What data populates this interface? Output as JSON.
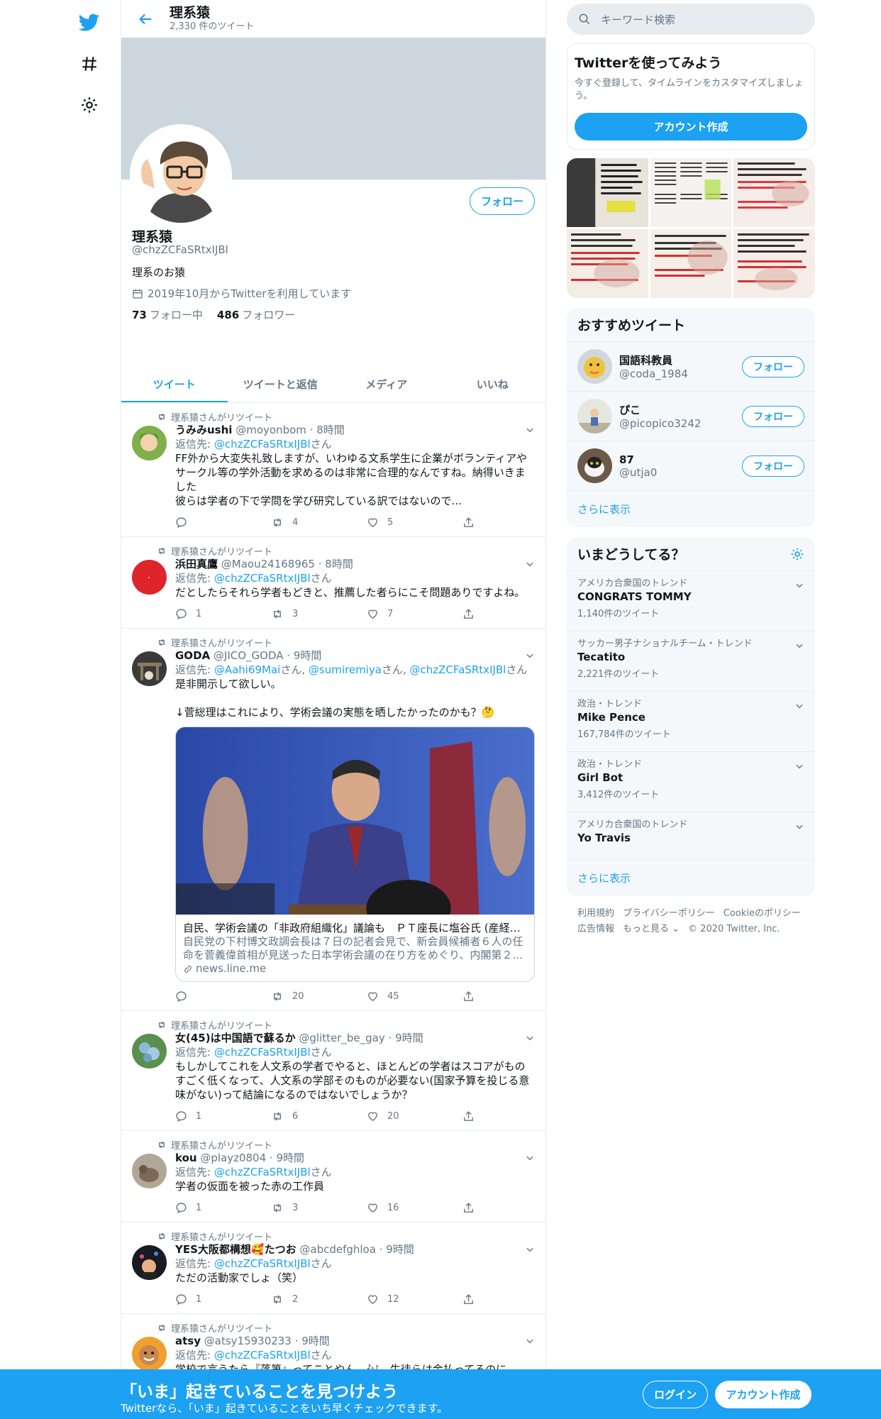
{
  "colors": {
    "accent": "#1da1f2",
    "muted": "#657786",
    "border": "#e6ecf0"
  },
  "header": {
    "title": "理系猿",
    "tweet_count": "2,330 件のツイート"
  },
  "profile": {
    "name": "理系猿",
    "handle": "@chzZCFaSRtxIJBl",
    "bio": "理系のお猿",
    "joined": "2019年10月からTwitterを利用しています",
    "following_count": "73",
    "following_label": "フォロー中",
    "followers_count": "486",
    "followers_label": "フォロワー",
    "follow_button": "フォロー"
  },
  "tabs": [
    "ツイート",
    "ツイートと返信",
    "メディア",
    "いいね"
  ],
  "tweets": [
    {
      "retweeted_by": "理系猿さんがリツイート",
      "name": "うみみushi",
      "handle": "@moyonbom",
      "time": "8時間",
      "reply_prefix": "返信先: ",
      "reply_to": "@chzZCFaSRtxIJBl",
      "reply_suffix": "さん",
      "body": "FF外から大変失礼致しますが、いわゆる文系学生に企業がボランティアや\nサークル等の学外活動を求めるのは非常に合理的なんですね。納得いきま\nした\n彼らは学者の下で学問を学び研究している訳ではないので...",
      "replies": "",
      "retweets": "4",
      "likes": "5"
    },
    {
      "retweeted_by": "理系猿さんがリツイート",
      "name": "浜田真鷹",
      "handle": "@Maou24168965",
      "time": "8時間",
      "reply_prefix": "返信先: ",
      "reply_to": "@chzZCFaSRtxIJBl",
      "reply_suffix": "さん",
      "body": "だとしたらそれら学者もどきと、推薦した者らにこそ問題ありですよね。",
      "replies": "1",
      "retweets": "3",
      "likes": "7"
    },
    {
      "retweeted_by": "理系猿さんがリツイート",
      "name": "GODA",
      "handle": "@JICO_GODA",
      "time": "9時間",
      "reply_prefix": "返信先: ",
      "reply_to_list": [
        "@Aahi69Mai",
        "@sumiremiya",
        "@chzZCFaSRtxIJBl"
      ],
      "reply_suffix": "さん",
      "body": "是非開示して欲しい。\n\n↓菅総理はこれにより、学術会議の実態を晒したかったのかも？🤔",
      "card": {
        "title": "自民、学術会議の「非政府組織化」議論も　ＰＴ座長に塩谷氏 (産経ニ...",
        "desc": "自民党の下村博文政調会長は７日の記者会見で、新会員候補者６人の任命を菅義偉首相が見送った日本学術会議の在り方をめぐり、内閣第２...",
        "domain": "news.line.me"
      },
      "replies": "",
      "retweets": "20",
      "likes": "45"
    },
    {
      "retweeted_by": "理系猿さんがリツイート",
      "name": "女(45)は中国語で蘇るか",
      "handle": "@glitter_be_gay",
      "time": "9時間",
      "reply_prefix": "返信先: ",
      "reply_to": "@chzZCFaSRtxIJBl",
      "reply_suffix": "さん",
      "body": "もしかしてこれを人文系の学者でやると、ほとんどの学者はスコアがもの\nすごく低くなって、人文系の学部そのものが必要ない(国家予算を投じる意\n味がない)って結論になるのではないでしょうか？",
      "replies": "1",
      "retweets": "6",
      "likes": "20"
    },
    {
      "retweeted_by": "理系猿さんがリツイート",
      "name": "kou",
      "handle": "@playz0804",
      "time": "9時間",
      "reply_prefix": "返信先: ",
      "reply_to": "@chzZCFaSRtxIJBl",
      "reply_suffix": "さん",
      "body": "学者の仮面を被った赤の工作員",
      "replies": "1",
      "retweets": "3",
      "likes": "16"
    },
    {
      "retweeted_by": "理系猿さんがリツイート",
      "name": "YES大阪都構想🥰たつお",
      "handle": "@abcdefghloa",
      "time": "9時間",
      "reply_prefix": "返信先: ",
      "reply_to": "@chzZCFaSRtxIJBl",
      "reply_suffix": "さん",
      "body": "ただの活動家でしょ（笑）",
      "replies": "1",
      "retweets": "2",
      "likes": "12"
    },
    {
      "retweeted_by": "理系猿さんがリツイート",
      "name": "atsy",
      "handle": "@atsy15930233",
      "time": "9時間",
      "reply_prefix": "返信先: ",
      "reply_to": "@chzZCFaSRtxIJBl",
      "reply_suffix": "さん",
      "body": "学校で言うたら『落第』ってことやん。🎶　生徒らは金払ってるのに。",
      "replies": "",
      "retweets": "",
      "likes": ""
    }
  ],
  "search": {
    "placeholder": "キーワード検索"
  },
  "signup_box": {
    "title": "Twitterを使ってみよう",
    "desc": "今すぐ登録して、タイムラインをカスタマイズしましょう。",
    "button": "アカウント作成"
  },
  "who_to_follow": {
    "title": "おすすめツイート",
    "users": [
      {
        "name": "国語科教員",
        "handle": "@coda_1984",
        "button": "フォロー"
      },
      {
        "name": "ぴこ",
        "handle": "@picopico3242",
        "button": "フォロー"
      },
      {
        "name": "87",
        "handle": "@utja0",
        "button": "フォロー"
      }
    ],
    "more": "さらに表示"
  },
  "trends": {
    "title": "いまどうしてる？",
    "items": [
      {
        "category": "アメリカ合衆国のトレンド",
        "name": "CONGRATS TOMMY",
        "count": "1,140件のツイート"
      },
      {
        "category": "サッカー男子ナショナルチーム・トレンド",
        "name": "Tecatito",
        "count": "2,221件のツイート"
      },
      {
        "category": "政治・トレンド",
        "name": "Mike Pence",
        "count": "167,784件のツイート"
      },
      {
        "category": "政治・トレンド",
        "name": "Girl Bot",
        "count": "3,412件のツイート"
      },
      {
        "category": "アメリカ合衆国のトレンド",
        "name": "Yo Travis",
        "count": ""
      }
    ],
    "more": "さらに表示"
  },
  "footer": {
    "links": [
      "利用規約",
      "プライバシーポリシー",
      "Cookieのポリシー",
      "広告情報",
      "もっと見る ⌄",
      "© 2020 Twitter, Inc."
    ]
  },
  "bottom_bar": {
    "title": "「いま」起きていることを見つけよう",
    "subtitle": "Twitterなら、「いま」起きていることをいち早くチェックできます。",
    "login": "ログイン",
    "signup": "アカウント作成"
  }
}
